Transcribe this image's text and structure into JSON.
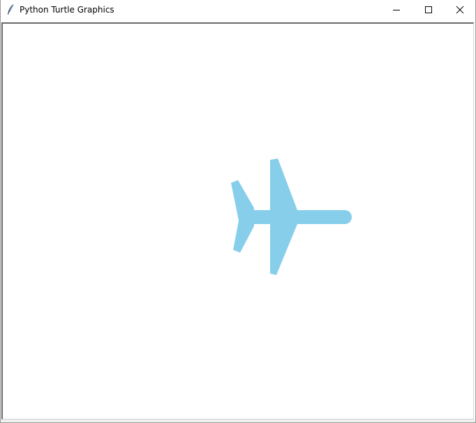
{
  "window": {
    "title": "Python Turtle Graphics",
    "icon": "feather-icon",
    "controls": {
      "minimize_icon": "minimize-icon",
      "maximize_icon": "maximize-icon",
      "close_icon": "close-icon"
    }
  },
  "canvas": {
    "background": "#ffffff",
    "shape": {
      "name": "airplane",
      "fill_color": "#87ceeb"
    }
  }
}
